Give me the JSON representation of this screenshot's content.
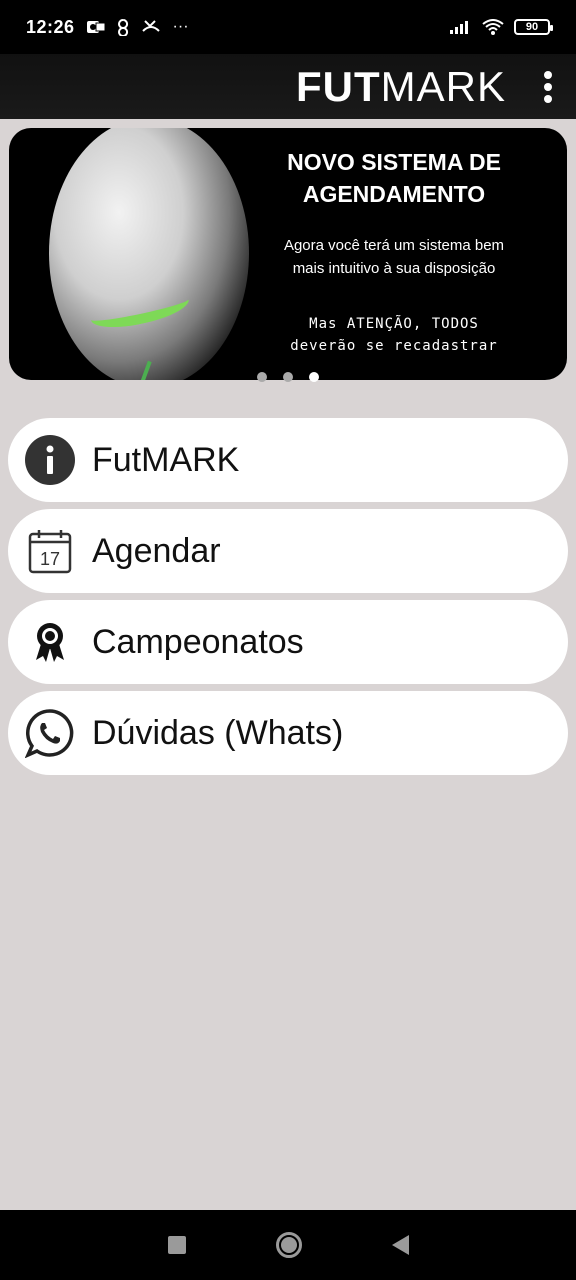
{
  "status_bar": {
    "time": "12:26",
    "dots": "···",
    "battery": "90"
  },
  "app_bar": {
    "logo_bold": "FUT",
    "logo_light": "MARK"
  },
  "banner": {
    "title_line1": "NOVO SISTEMA DE",
    "title_line2": "AGENDAMENTO",
    "subtitle_line1": "Agora você terá um sistema bem",
    "subtitle_line2": "mais intuitivo à sua disposição",
    "warning_line1": "Mas ATENÇÃO, TODOS",
    "warning_line2": "deverão se recadastrar",
    "active_slide": 3,
    "slide_count": 3
  },
  "menu": {
    "items": [
      {
        "label": "FutMARK",
        "icon": "info-icon"
      },
      {
        "label": "Agendar",
        "icon": "calendar-icon",
        "icon_text": "17"
      },
      {
        "label": "Campeonatos",
        "icon": "medal-icon"
      },
      {
        "label": "Dúvidas (Whats)",
        "icon": "whatsapp-icon"
      }
    ]
  }
}
